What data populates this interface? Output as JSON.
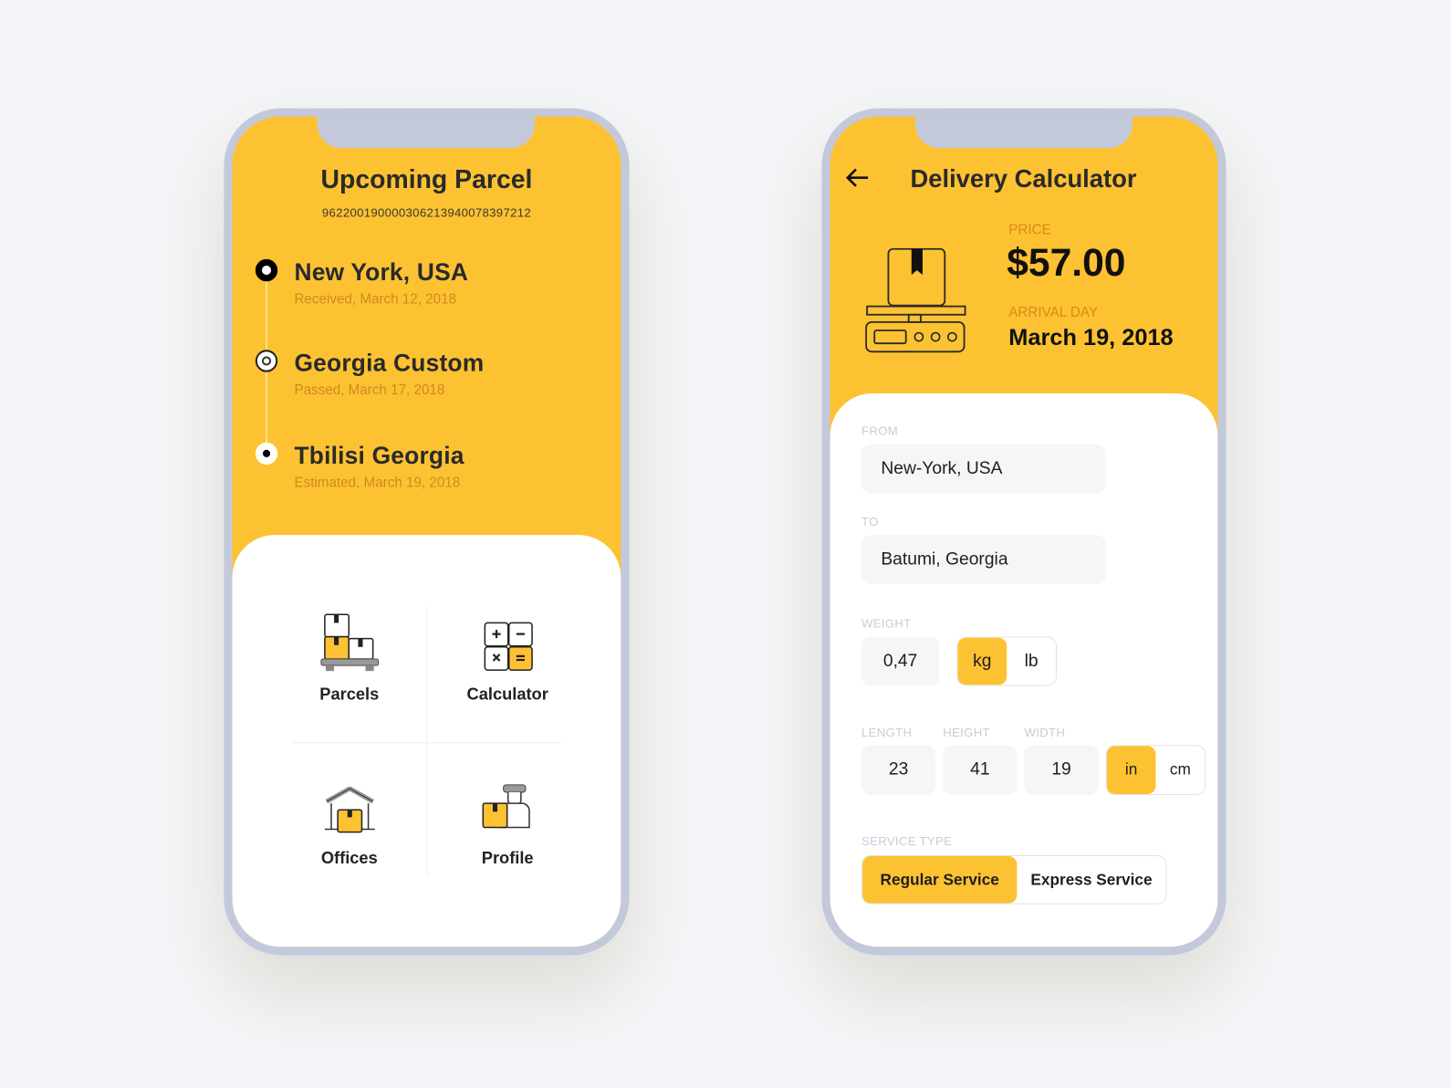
{
  "colors": {
    "accent": "#fdc232",
    "frame": "#c3c9db",
    "label_orange": "#d98a17",
    "muted_label": "#c8ccd8"
  },
  "upcoming": {
    "title": "Upcoming Parcel",
    "tracking_number": "962200190000306213940078397212",
    "timeline": [
      {
        "name": "New York, USA",
        "status": "Received, March 12, 2018",
        "state": "completed"
      },
      {
        "name": "Georgia Custom",
        "status": "Passed, March 17, 2018",
        "state": "passed"
      },
      {
        "name": "Tbilisi Georgia",
        "status": "Estimated, March 19, 2018",
        "state": "estimated"
      }
    ],
    "menu": [
      {
        "label": "Parcels",
        "icon": "parcels-icon"
      },
      {
        "label": "Calculator",
        "icon": "calculator-icon"
      },
      {
        "label": "Offices",
        "icon": "offices-icon"
      },
      {
        "label": "Profile",
        "icon": "profile-icon"
      }
    ]
  },
  "calculator": {
    "title": "Delivery Calculator",
    "back_icon": "arrow-left-icon",
    "price_label": "PRICE",
    "price": "$57.00",
    "arrival_label": "ARRIVAL DAY",
    "arrival": "March 19, 2018",
    "from_label": "FROM",
    "from_value": "New-York, USA",
    "to_label": "TO",
    "to_value": "Batumi, Georgia",
    "weight_label": "WEIGHT",
    "weight_value": "0,47",
    "weight_units": [
      "kg",
      "lb"
    ],
    "weight_unit_selected": "kg",
    "length_label": "LENGTH",
    "length_value": "23",
    "height_label": "HEIGHT",
    "height_value": "41",
    "width_label": "WIDTH",
    "width_value": "19",
    "dim_units": [
      "in",
      "cm"
    ],
    "dim_unit_selected": "in",
    "service_label": "SERVICE TYPE",
    "services": [
      "Regular Service",
      "Express Service"
    ],
    "service_selected": "Regular Service"
  }
}
